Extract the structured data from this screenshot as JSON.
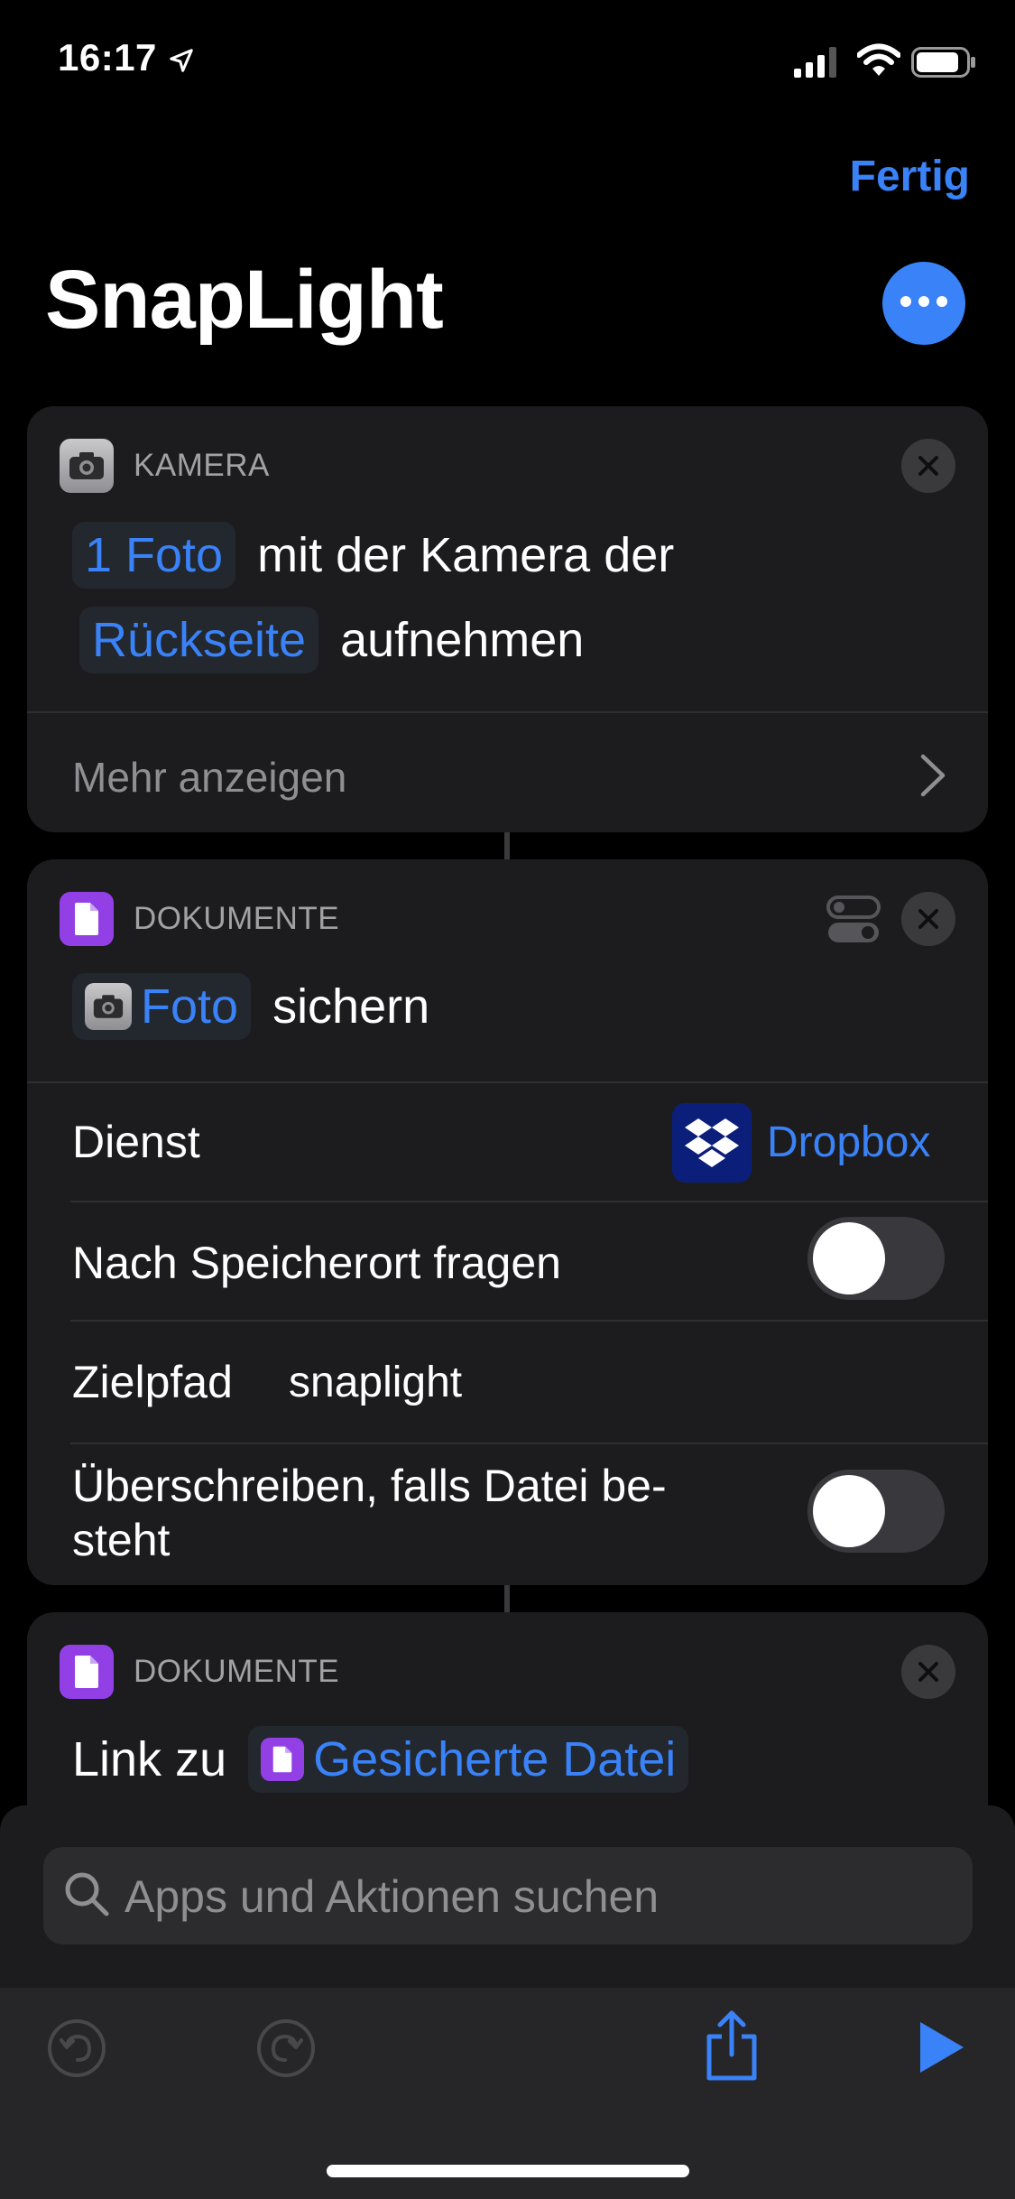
{
  "status_bar": {
    "time": "16:17"
  },
  "nav": {
    "done_label": "Fertig",
    "title": "SnapLight"
  },
  "actions": [
    {
      "category": "KAMERA",
      "line1_token": "1 Foto",
      "line1_text": "mit der Kamera der",
      "line2_token": "Rückseite",
      "line2_text": "aufnehmen",
      "more_label": "Mehr anzeigen"
    },
    {
      "category": "DOKUMENTE",
      "token": "Foto",
      "text": "sichern",
      "rows": {
        "service_label": "Dienst",
        "service_value": "Dropbox",
        "ask_location_label": "Nach Speicherort fragen",
        "ask_location_on": false,
        "dest_path_label": "Zielpfad",
        "dest_path_value": "snaplight",
        "overwrite_label_line1": "Überschreiben, falls Datei be-",
        "overwrite_label_line2": "steht",
        "overwrite_on": false
      }
    },
    {
      "category": "DOKUMENTE",
      "text": "Link zu",
      "token": "Gesicherte Datei"
    }
  ],
  "search": {
    "placeholder": "Apps und Aktionen suchen"
  },
  "colors": {
    "accent": "#3a82f7",
    "card": "#1c1c1e",
    "background": "#000000",
    "documents": "#9240e6",
    "dropbox": "#0b1f7a"
  },
  "icons": [
    "location-arrow-icon",
    "signal-icon",
    "wifi-icon",
    "battery-icon",
    "more-icon",
    "camera-icon",
    "document-icon",
    "close-icon",
    "chevron-right-icon",
    "variant-toggle-icon",
    "dropbox-icon",
    "search-icon",
    "undo-icon",
    "redo-icon",
    "share-icon",
    "play-icon"
  ]
}
